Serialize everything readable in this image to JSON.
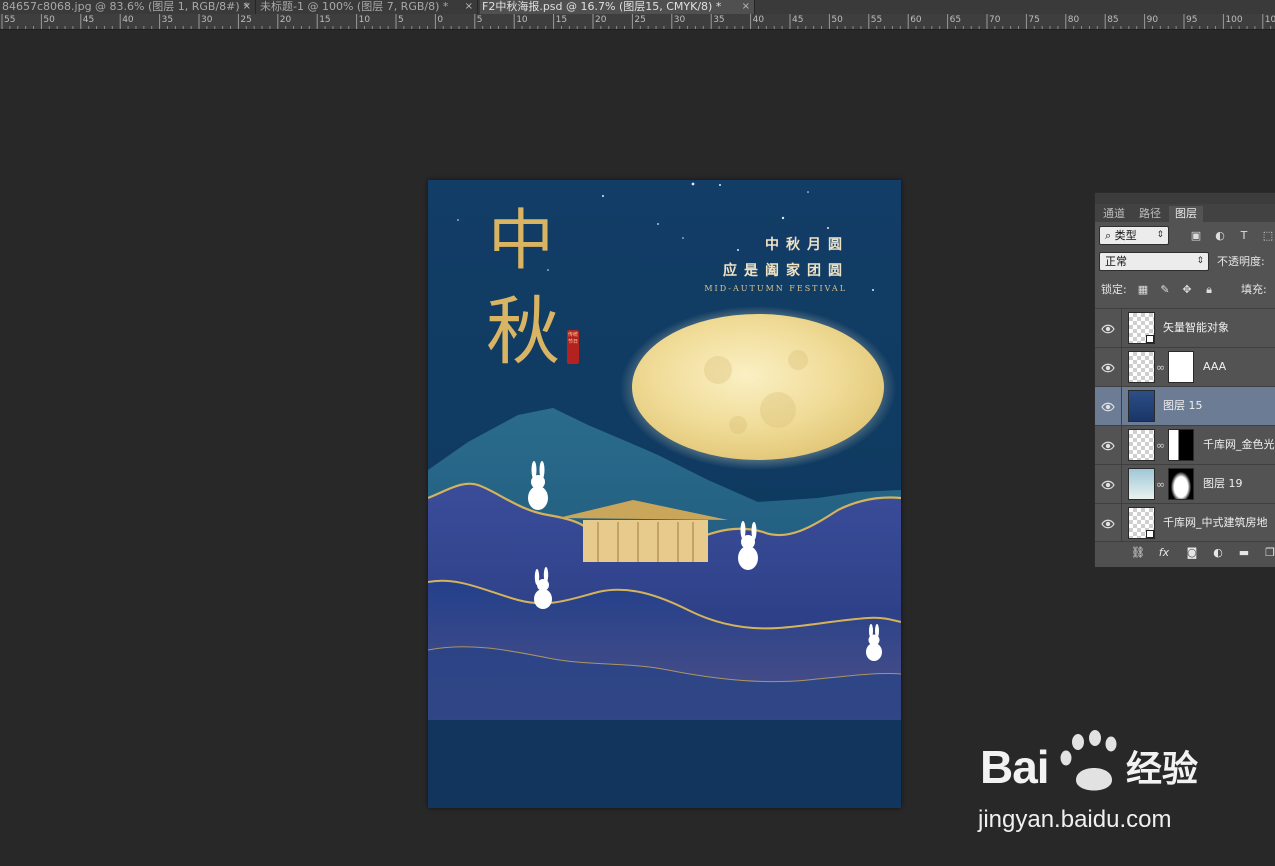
{
  "tabs": [
    {
      "label": "84657c8068.jpg @ 83.6% (图层 1, RGB/8#) *",
      "active": false
    },
    {
      "label": "未标题-1 @ 100% (图层 7, RGB/8) *",
      "active": false
    },
    {
      "label": "F2中秋海报.psd @ 16.7% (图层15, CMYK/8) *",
      "active": true
    }
  ],
  "tab_close_glyph": "×",
  "ruler": {
    "labels": [
      "55",
      "50",
      "45",
      "40",
      "35",
      "30",
      "25",
      "20",
      "15",
      "10",
      "5",
      "0",
      "5",
      "10",
      "15",
      "20",
      "25",
      "30",
      "35",
      "40",
      "45",
      "50",
      "55",
      "60",
      "65",
      "70",
      "75",
      "80",
      "85",
      "90",
      "95",
      "100",
      "105"
    ]
  },
  "poster": {
    "title_char_1": "中",
    "title_char_2": "秋",
    "seal_text": "传统节日",
    "line1": "中秋月圆",
    "line2": "应是阖家团圆",
    "line3": "MID-AUTUMN FESTIVAL",
    "colors": {
      "sky_top": "#0f3a62",
      "sky_bottom": "#0d3458",
      "gold": "#d9b463",
      "moon": "#f3e4a8"
    }
  },
  "layers_panel": {
    "tabs": [
      "通道",
      "路径",
      "图层"
    ],
    "active_tab": "图层",
    "filter_label": "类型",
    "blend_mode": "正常",
    "opacity_label": "不透明度:",
    "lock_label": "锁定:",
    "fill_label": "填充:",
    "layers": [
      {
        "name": "矢量智能对象",
        "visible": true,
        "selected": false,
        "has_mask": false
      },
      {
        "name": "AAA",
        "visible": true,
        "selected": false,
        "has_mask": true
      },
      {
        "name": "图层 15",
        "visible": true,
        "selected": true,
        "has_mask": false
      },
      {
        "name": "千库网_金色光",
        "visible": true,
        "selected": false,
        "has_mask": true
      },
      {
        "name": "图层 19",
        "visible": true,
        "selected": false,
        "has_mask": true
      },
      {
        "name": "千库网_中式建筑房地",
        "visible": true,
        "selected": false,
        "has_mask": false
      }
    ],
    "footer_icons": [
      "link-icon",
      "fx-icon",
      "mask-icon",
      "adjustment-icon",
      "folder-icon",
      "new-layer-icon"
    ],
    "footer_fx": "fx"
  },
  "watermark": {
    "logo": "Bai",
    "logo_suffix": "经验",
    "url": "jingyan.baidu.com"
  }
}
